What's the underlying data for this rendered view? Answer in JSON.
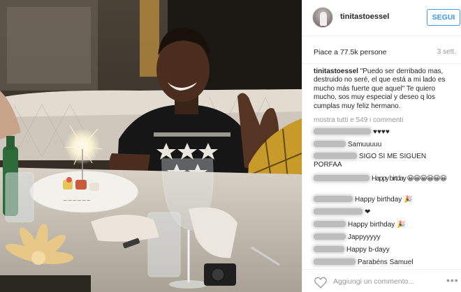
{
  "post": {
    "username": "tinitastoessel",
    "follow_label": "SEGUI",
    "likes": "Piace a 77.5k persone",
    "time": "3 sett.",
    "caption_user": "tinitastoessel",
    "caption": "\"Puedo ser derribado mas, destruido no seré, el que está a mi lado es mucho más fuerte que aquel\" Te quiero mucho, sos muy especial y deseo q los cumplas muy feliz hermano.",
    "more_comments": "mostra tutti e 549 i commenti",
    "add_comment_placeholder": "Aggiungi un commento...",
    "more_icon": "•••"
  },
  "comments": [
    {
      "text": "♥♥♥♥"
    },
    {
      "text": "Samuuuuu"
    },
    {
      "text": "SIGO SI ME SIGUEN PORFAA"
    },
    {
      "text": "Happy birtday 😀😀😀😀😀😀"
    },
    {
      "text": "Happy birthday 🎉"
    },
    {
      "text": "❤"
    },
    {
      "text": "Happy birthday 🎉"
    },
    {
      "text": "Jappyyyyy"
    },
    {
      "text": "Happy b-dayy"
    },
    {
      "text": "Parabéns Samuel"
    }
  ],
  "colors": {
    "accent": "#3897f0",
    "muted": "#999999",
    "text": "#262626"
  },
  "icons": {
    "like": "heart-outline-icon",
    "more": "more-options-icon"
  }
}
